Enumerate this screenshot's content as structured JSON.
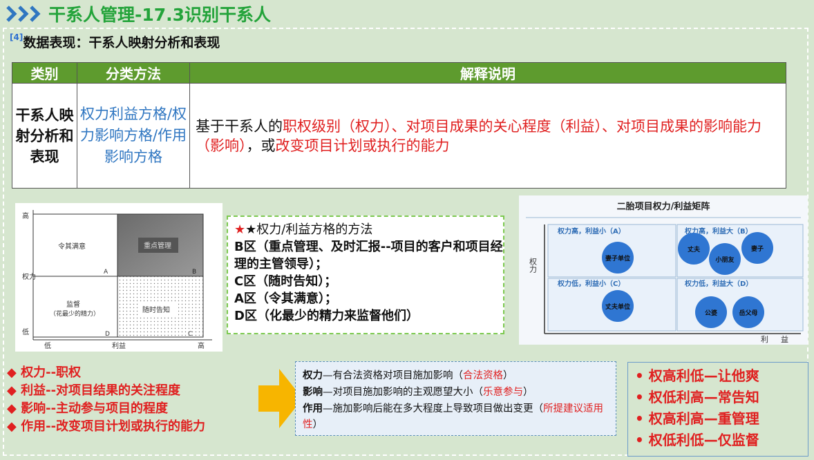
{
  "header": {
    "title": "干系人管理-17.3识别干系人"
  },
  "subtitle": {
    "marker": "[4]",
    "text": "数据表现：干系人映射分析和表现"
  },
  "table": {
    "headers": [
      "类别",
      "分类方法",
      "解释说明"
    ],
    "category": "干系人映射分析和表现",
    "method": "权力利益方格/权力影响方格/作用影响方格",
    "desc_parts": [
      "基于干系人的",
      "职权级别（权力）、对项目成果的关心程度（利益）、对项目成果的影响能力（影响）",
      "，或",
      "改变项目计划或执行的能力"
    ]
  },
  "grid": {
    "y_high": "高",
    "y_label": "权力",
    "y_low": "低",
    "x_low": "低",
    "x_label": "利益",
    "x_high": "高",
    "cells": {
      "A": {
        "label": "令其满意",
        "letter": "A"
      },
      "B": {
        "label": "重点管理",
        "letter": "B"
      },
      "D": {
        "label": "监督",
        "sub": "（花最少的精力）",
        "letter": "D"
      },
      "C": {
        "label": "随时告知",
        "letter": "C"
      }
    }
  },
  "method_box": {
    "lines": [
      "★权力/利益方格的方法",
      "B区（重点管理、及时汇报--项目的客户和项目经理的主管领导）；",
      "C区（随时告知）；",
      "A区（令其满意）；",
      "D区（化最少的精力来监督他们）"
    ]
  },
  "matrix": {
    "title": "二胎项目权力/利益矩阵",
    "y_axis": "权力",
    "x_axis": "利益",
    "quadrants": [
      {
        "label": "权力高，利益小（A）",
        "items": [
          "妻子单位"
        ]
      },
      {
        "label": "权力高，利益大（B）",
        "items": [
          "丈夫",
          "小朋友",
          "妻子"
        ]
      },
      {
        "label": "权力低，利益小（C）",
        "items": [
          "丈夫单位"
        ]
      },
      {
        "label": "权力低，利益大（D）",
        "items": [
          "公婆",
          "岳父母"
        ]
      }
    ]
  },
  "bullets": [
    "◆ 权力--职权",
    "◆ 利益--对项目结果的关注程度",
    "◆ 影响--主动参与项目的程度",
    "◆ 作用--改变项目计划或执行的能力"
  ],
  "definitions": {
    "power": {
      "term": "权力",
      "text": "—有合法资格对项目施加影响（",
      "highlight": "合法资格",
      "end": "）"
    },
    "influence": {
      "term": "影响",
      "text": "—对项目施加影响的主观愿望大小（",
      "highlight": "乐意参与",
      "end": "）"
    },
    "role": {
      "term": "作用",
      "text": "—施加影响后能在多大程度上导致项目做出变更（",
      "highlight": "所提建议适用性",
      "end": "）"
    }
  },
  "summary": [
    "• 权高利低—让他爽",
    "• 权低利高—常告知",
    "• 权高利高—重管理",
    "• 权低利低—仅监督"
  ]
}
